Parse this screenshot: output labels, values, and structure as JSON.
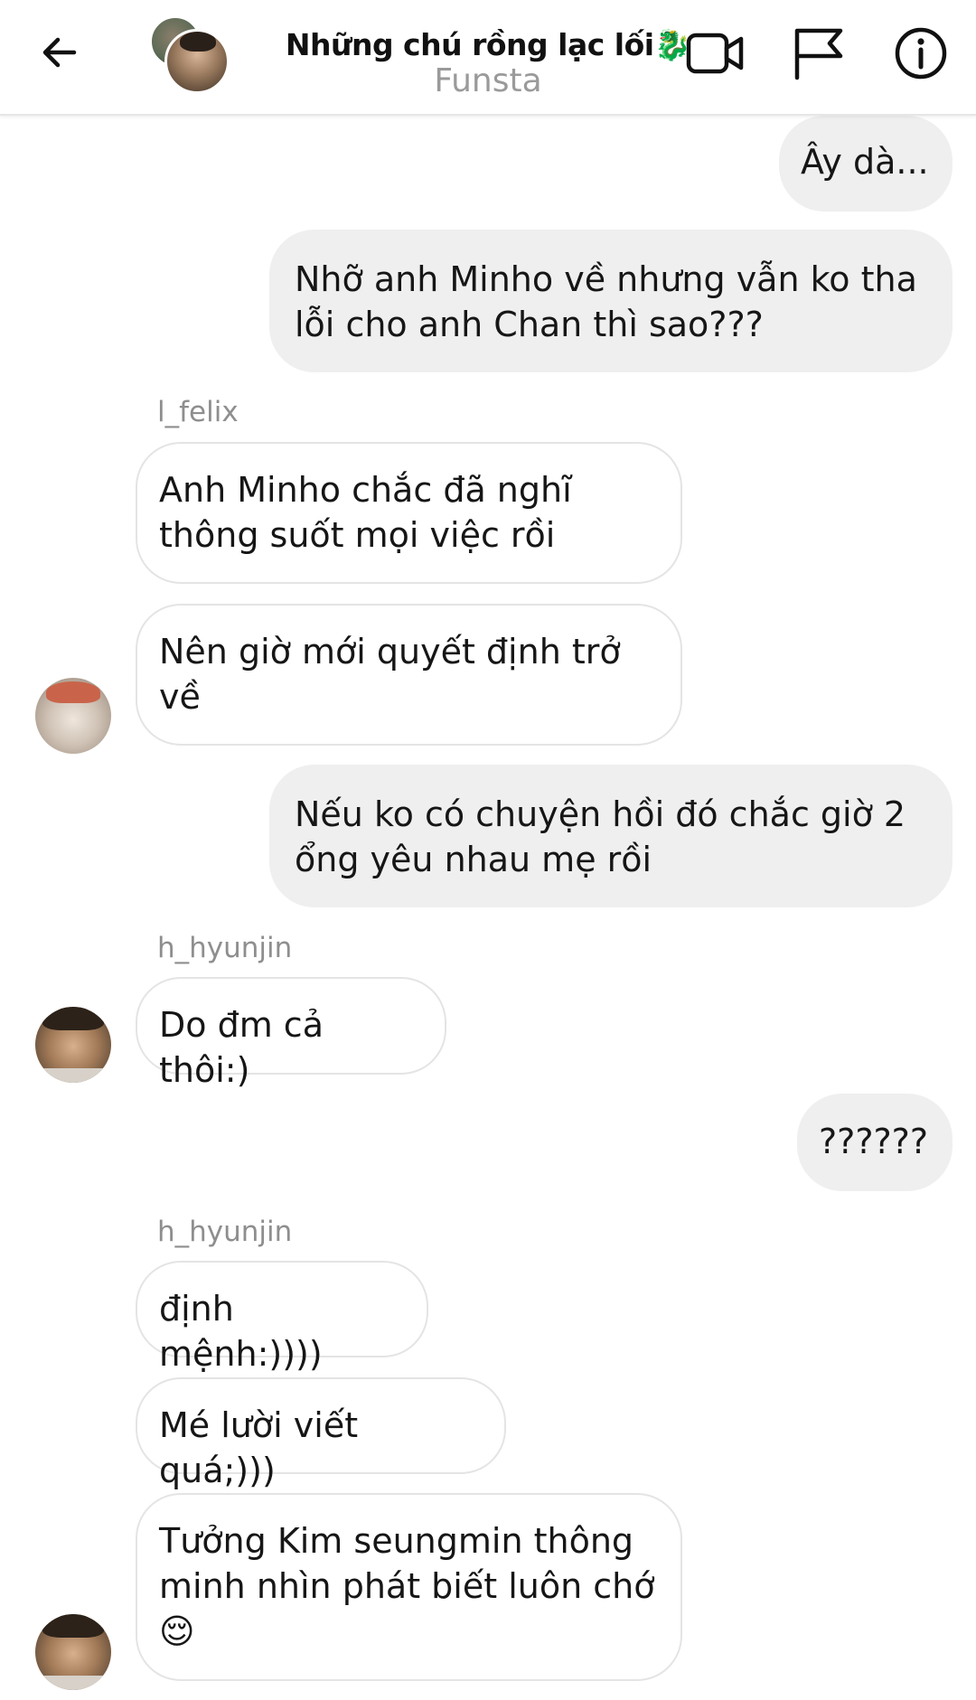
{
  "header": {
    "title": "Những chú rồng lạc lối🐉",
    "subtitle": "Funsta",
    "icons": {
      "back": "arrow-left-icon",
      "video": "video-camera-icon",
      "flag": "flag-icon",
      "info": "info-icon"
    }
  },
  "messages": [
    {
      "direction": "out",
      "text": "Ây dà..."
    },
    {
      "direction": "out",
      "text": "Nhỡ anh Minho về nhưng vẫn ko tha lỗi cho anh Chan thì sao???"
    },
    {
      "direction": "in",
      "sender": "l_felix",
      "text": "Anh Minho chắc đã nghĩ thông suốt mọi việc rồi"
    },
    {
      "direction": "in",
      "sender": "l_felix",
      "text": "Nên giờ mới quyết định trở về"
    },
    {
      "direction": "out",
      "text": "Nếu ko có chuyện hồi đó chắc giờ 2 ổng yêu nhau mẹ rồi"
    },
    {
      "direction": "in",
      "sender": "h_hyunjin",
      "text": "Do đm cả thôi:)"
    },
    {
      "direction": "out",
      "text": "??????"
    },
    {
      "direction": "in",
      "sender": "h_hyunjin",
      "text": "định mệnh:))))"
    },
    {
      "direction": "in",
      "sender": "h_hyunjin",
      "text": "Mé lười viết quá;)))"
    },
    {
      "direction": "in",
      "sender": "h_hyunjin",
      "text": "Tưởng Kim seungmin thông minh nhìn phát biết luôn chớ 😌"
    }
  ],
  "senders": {
    "felix": "l_felix",
    "hyunjin": "h_hyunjin"
  },
  "colors": {
    "outgoing_bubble": "#efefef",
    "incoming_border": "#e4e4e4",
    "sender_label": "#8e8e8e",
    "subtitle": "#9a9a9a"
  }
}
